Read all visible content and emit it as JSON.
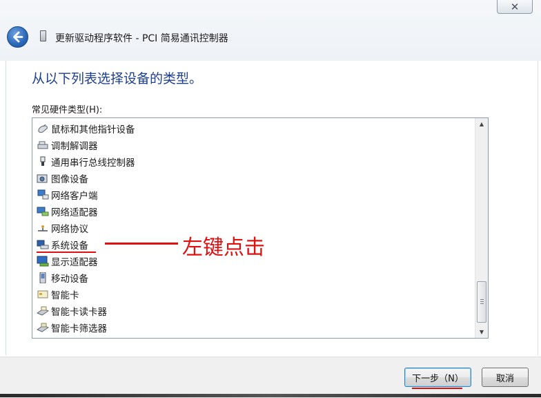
{
  "window": {
    "title": "更新驱动程序软件 - PCI 简易通讯控制器",
    "close_glyph": "✕"
  },
  "main": {
    "heading": "从以下列表选择设备的类型。",
    "list_label": "常见硬件类型(H):",
    "items": [
      {
        "label": "鼠标和其他指针设备",
        "icon": "mouse-icon"
      },
      {
        "label": "调制解调器",
        "icon": "modem-icon"
      },
      {
        "label": "通用串行总线控制器",
        "icon": "usb-icon"
      },
      {
        "label": "图像设备",
        "icon": "camera-icon"
      },
      {
        "label": "网络客户端",
        "icon": "network-client-icon"
      },
      {
        "label": "网络适配器",
        "icon": "network-adapter-icon"
      },
      {
        "label": "网络协议",
        "icon": "protocol-icon"
      },
      {
        "label": "系统设备",
        "icon": "system-device-icon"
      },
      {
        "label": "显示适配器",
        "icon": "display-adapter-icon"
      },
      {
        "label": "移动设备",
        "icon": "mobile-device-icon"
      },
      {
        "label": "智能卡",
        "icon": "smart-card-icon"
      },
      {
        "label": "智能卡读卡器",
        "icon": "card-reader-icon"
      },
      {
        "label": "智能卡筛选器",
        "icon": "card-filter-icon"
      }
    ]
  },
  "annotation": {
    "text": "左键点击",
    "color": "#e01010"
  },
  "buttons": {
    "next": "下一步（N）",
    "cancel": "取消"
  },
  "colors": {
    "heading": "#1e3f8e",
    "accent": "#2a67b8"
  }
}
